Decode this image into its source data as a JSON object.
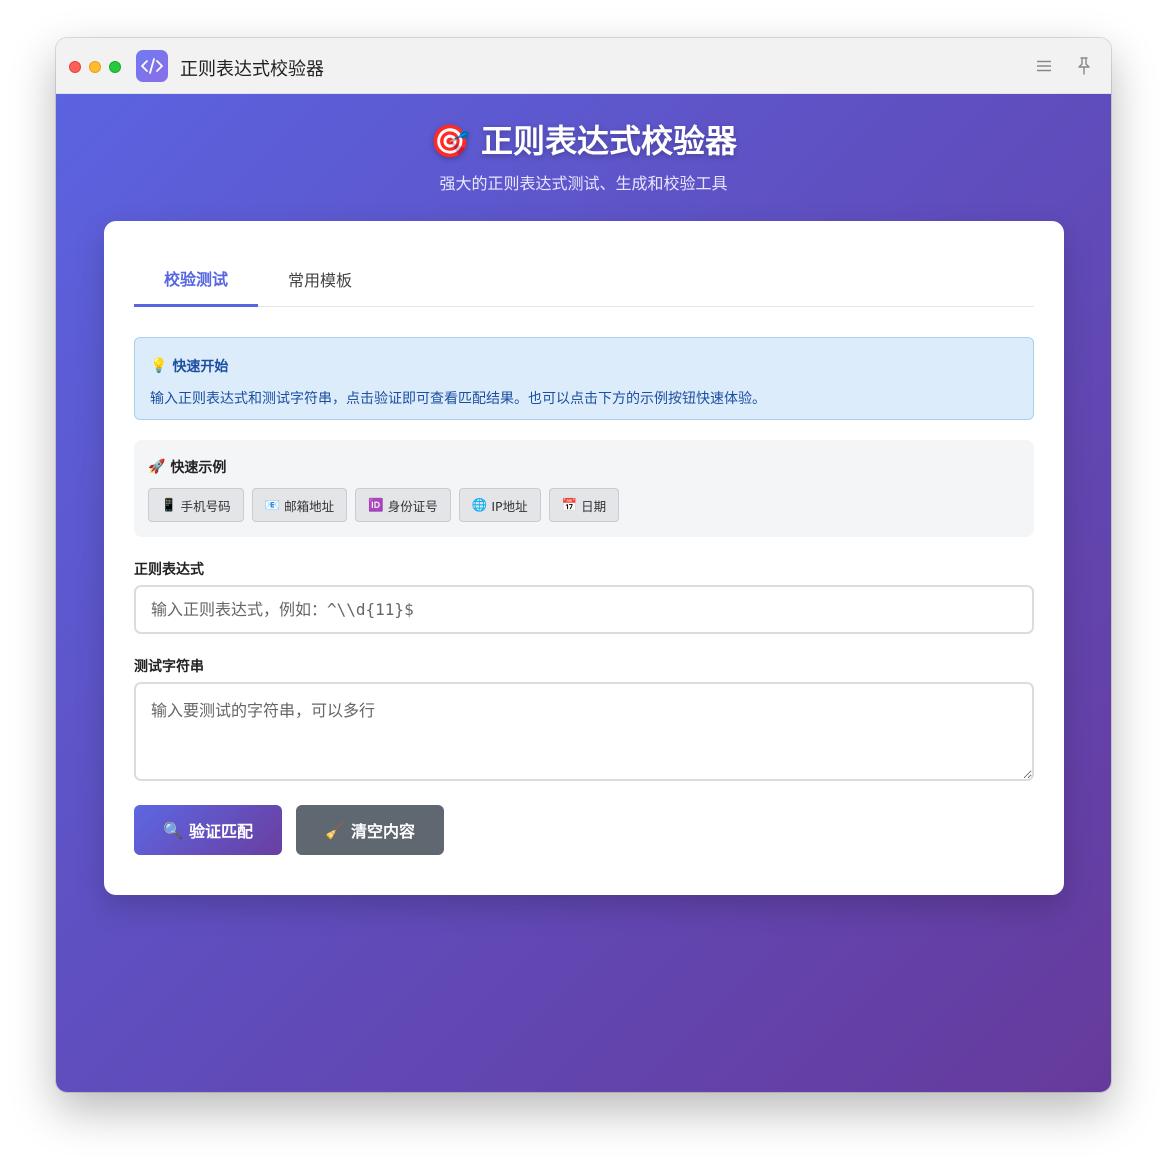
{
  "window": {
    "title": "正则表达式校验器",
    "controls": [
      "close",
      "minimize",
      "zoom"
    ],
    "toolbar_icons": [
      "menu-icon",
      "pin-icon"
    ]
  },
  "header": {
    "emoji": "🎯",
    "title": "正则表达式校验器",
    "subtitle": "强大的正则表达式测试、生成和校验工具"
  },
  "tabs": [
    {
      "label": "校验测试",
      "active": true
    },
    {
      "label": "常用模板",
      "active": false
    }
  ],
  "tip": {
    "emoji": "💡",
    "title": "快速开始",
    "body": "输入正则表达式和测试字符串，点击验证即可查看匹配结果。也可以点击下方的示例按钮快速体验。"
  },
  "examples": {
    "emoji": "🚀",
    "title": "快速示例",
    "buttons": [
      {
        "emoji": "📱",
        "label": "手机号码"
      },
      {
        "emoji": "📧",
        "label": "邮箱地址"
      },
      {
        "emoji": "🆔",
        "label": "身份证号"
      },
      {
        "emoji": "🌐",
        "label": "IP地址"
      },
      {
        "emoji": "📅",
        "label": "日期"
      }
    ]
  },
  "regex_field": {
    "label": "正则表达式",
    "value": "",
    "placeholder": "输入正则表达式，例如：^\\\\d{11}$"
  },
  "test_field": {
    "label": "测试字符串",
    "value": "",
    "placeholder": "输入要测试的字符串，可以多行"
  },
  "actions": {
    "validate": {
      "emoji": "🔍",
      "label": "验证匹配"
    },
    "clear": {
      "emoji": "🧹",
      "label": "清空内容"
    }
  },
  "colors": {
    "accent": "#5566e0",
    "gradient_start": "#5b63e0",
    "gradient_end": "#663a9c",
    "tip_bg": "#dcecfb",
    "tip_text": "#1c4fa0",
    "secondary_button": "#5f6770"
  }
}
